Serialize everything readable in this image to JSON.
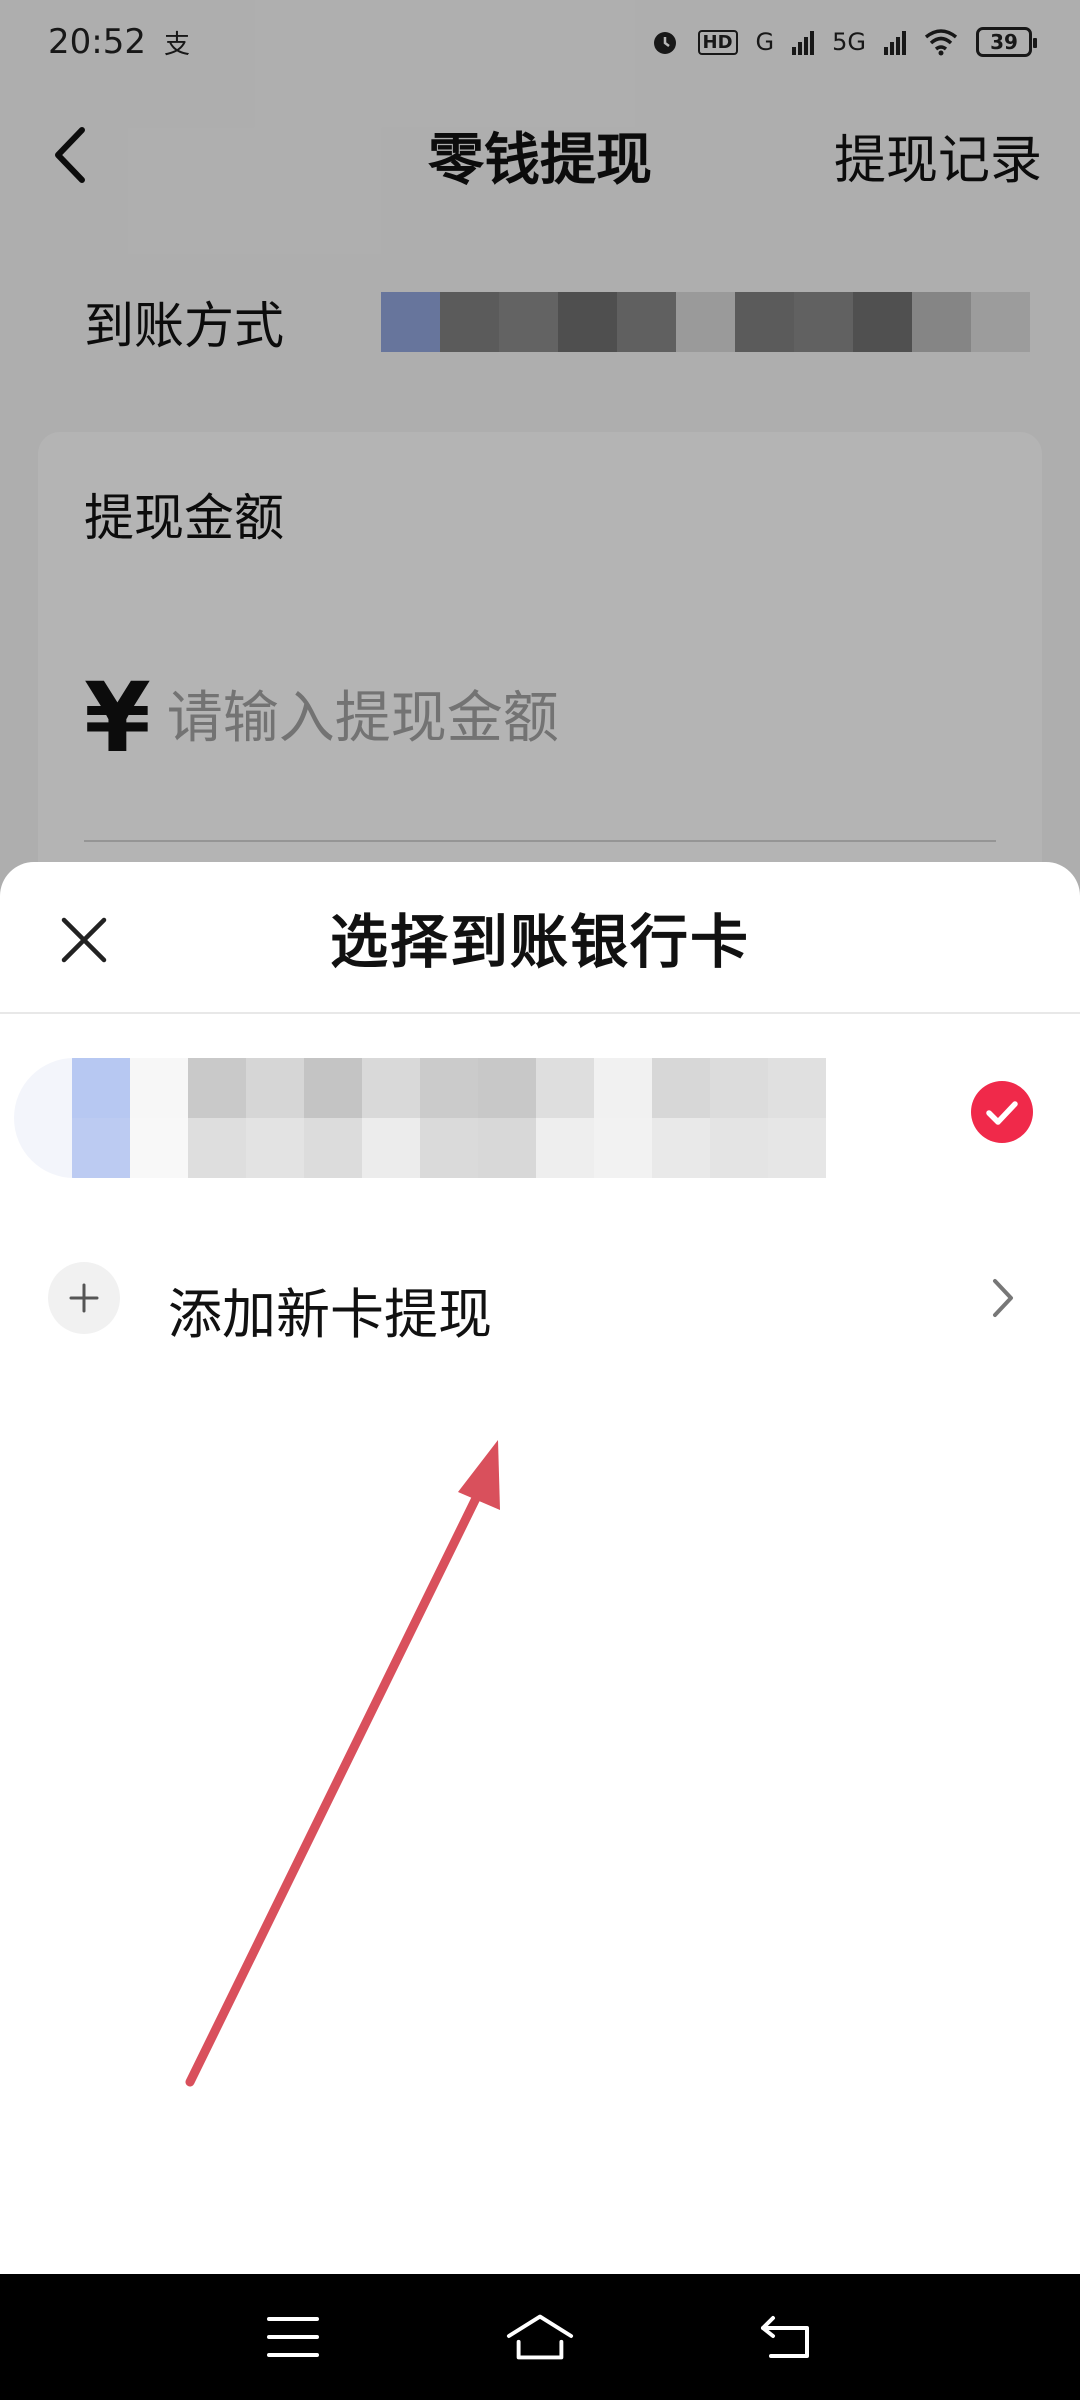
{
  "status_bar": {
    "time": "20:52",
    "app_indicator": "支",
    "network_hd": "HD",
    "network_g": "G",
    "network_5g": "5G",
    "battery": "39"
  },
  "header": {
    "title": "零钱提现",
    "records_label": "提现记录"
  },
  "withdraw_form": {
    "method_label": "到账方式",
    "amount_label": "提现金额",
    "currency_symbol": "¥",
    "amount_placeholder": "请输入提现金额"
  },
  "sheet": {
    "title": "选择到账银行卡",
    "add_card_label": "添加新卡提现"
  },
  "colors": {
    "accent_red": "#f0294a",
    "arrow": "#d9505c",
    "text_primary": "#111111",
    "placeholder": "#a0a0a0"
  },
  "icons": {
    "back": "chevron-left-icon",
    "close": "close-icon",
    "selected": "check-circle-icon",
    "add": "plus-icon",
    "row_chevron": "chevron-right-icon",
    "nav_menu": "menu-icon",
    "nav_home": "home-icon",
    "nav_back": "back-icon"
  }
}
